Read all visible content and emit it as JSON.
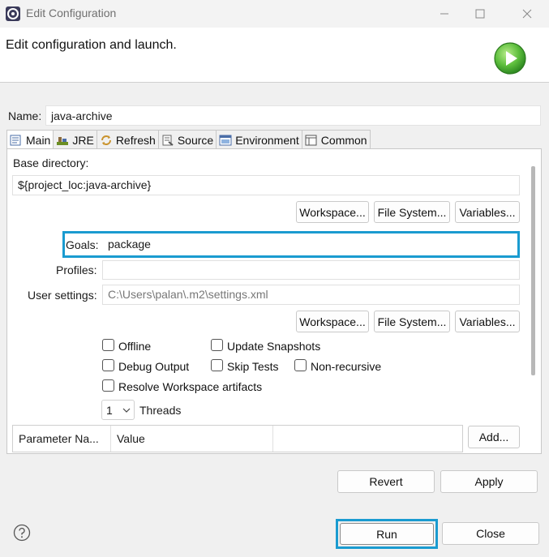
{
  "window": {
    "title": "Edit Configuration"
  },
  "banner": {
    "heading": "Edit configuration and launch."
  },
  "name": {
    "label": "Name:",
    "value": "java-archive"
  },
  "tabs": [
    {
      "label": "Main",
      "icon": "main-tab-icon",
      "active": true
    },
    {
      "label": "JRE",
      "icon": "jre-icon"
    },
    {
      "label": "Refresh",
      "icon": "refresh-icon"
    },
    {
      "label": "Source",
      "icon": "source-icon"
    },
    {
      "label": "Environment",
      "icon": "environment-icon"
    },
    {
      "label": "Common",
      "icon": "common-icon"
    }
  ],
  "main": {
    "base_directory": {
      "label": "Base directory:",
      "value": "${project_loc:java-archive}"
    },
    "base_buttons": {
      "workspace": "Workspace...",
      "file_system": "File System...",
      "variables": "Variables..."
    },
    "goals": {
      "label": "Goals:",
      "value": "package"
    },
    "profiles": {
      "label": "Profiles:",
      "value": ""
    },
    "user_settings": {
      "label": "User settings:",
      "value": "C:\\Users\\palan\\.m2\\settings.xml"
    },
    "settings_buttons": {
      "workspace": "Workspace...",
      "file_system": "File System...",
      "variables": "Variables..."
    },
    "options": {
      "offline": {
        "label": "Offline",
        "checked": false
      },
      "update_snapshots": {
        "label": "Update Snapshots",
        "checked": false
      },
      "debug_output": {
        "label": "Debug Output",
        "checked": false
      },
      "skip_tests": {
        "label": "Skip Tests",
        "checked": false
      },
      "non_recursive": {
        "label": "Non-recursive",
        "checked": false
      },
      "resolve_workspace": {
        "label": "Resolve Workspace artifacts",
        "checked": false
      }
    },
    "threads": {
      "value": "1",
      "label": "Threads"
    },
    "parameters": {
      "columns": [
        "Parameter Na...",
        "Value"
      ],
      "add_button": "Add..."
    }
  },
  "actions": {
    "revert": "Revert",
    "apply": "Apply",
    "run": "Run",
    "close": "Close"
  },
  "colors": {
    "highlight": "#1a9bd0",
    "launch_icon": "#4fb83a"
  }
}
